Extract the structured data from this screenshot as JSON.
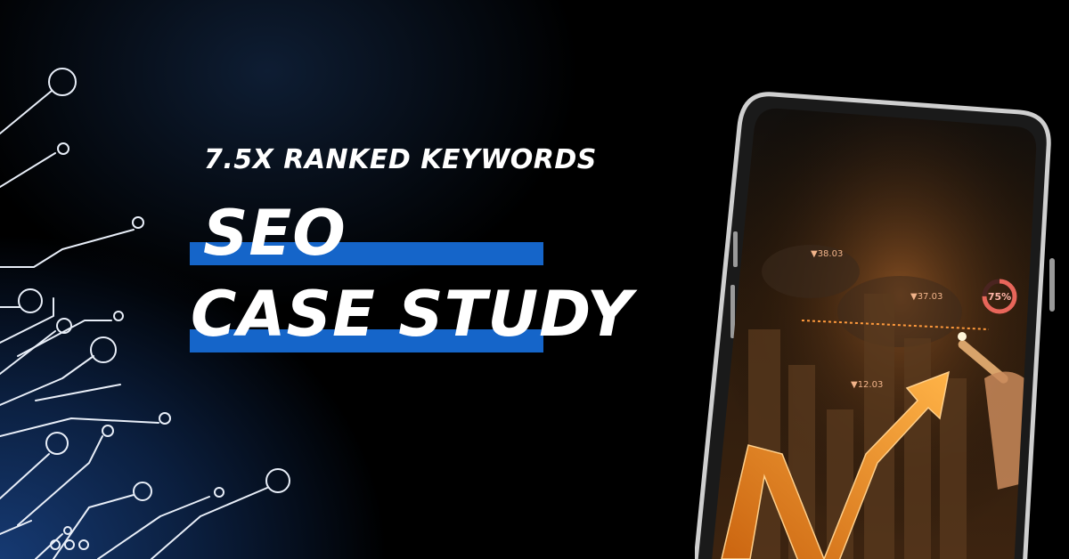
{
  "headline": {
    "subtitle": "7.5X RANKED KEYWORDS",
    "title_line_1": "SEO",
    "title_line_2": "CASE STUDY"
  },
  "phone_screen": {
    "progress_label": "75%",
    "progress_fraction": 0.75,
    "value_labels": [
      "▼38.03",
      "▼37.03",
      "▼12.03"
    ]
  },
  "colors": {
    "accent_bar": "#1565c9",
    "text": "#ffffff",
    "arrow": "#f08a1c",
    "ring": "#e8665a",
    "background": "#000000"
  },
  "icons": [
    "circuit-lines-graphic",
    "smartphone-graphic",
    "growth-arrow-icon",
    "pen-icon"
  ]
}
